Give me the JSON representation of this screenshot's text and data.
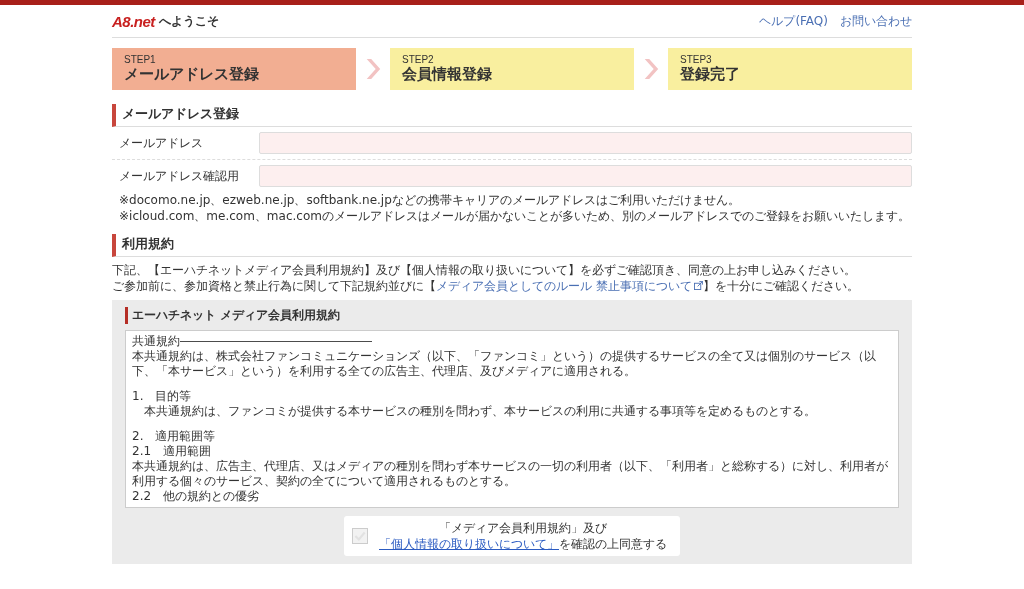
{
  "header": {
    "logo": "A8.net",
    "welcome": "へようこそ",
    "links": [
      "ヘルプ(FAQ)",
      "お問い合わせ"
    ]
  },
  "steps": [
    {
      "step": "STEP1",
      "label": "メールアドレス登録",
      "selected": true
    },
    {
      "step": "STEP2",
      "label": "会員情報登録",
      "selected": false
    },
    {
      "step": "STEP3",
      "label": "登録完了",
      "selected": false
    }
  ],
  "email_section": {
    "title": "メールアドレス登録",
    "fields": [
      {
        "label": "メールアドレス"
      },
      {
        "label": "メールアドレス確認用"
      }
    ],
    "notes": [
      "※docomo.ne.jp、ezweb.ne.jp、softbank.ne.jpなどの携帯キャリアのメールアドレスはご利用いただけません。",
      "※icloud.com、me.com、mac.comのメールアドレスはメールが届かないことが多いため、別のメールアドレスでのご登録をお願いいたします。"
    ]
  },
  "terms_section": {
    "title": "利用規約",
    "intro": "下記、【エーハチネットメディア会員利用規約】及び【個人情報の取り扱いについて】を必ずご確認頂き、同意の上お申し込みください。",
    "rules_before": "ご参加前に、参加資格と禁止行為に関して下記規約並びに【",
    "rules_link": "メディア会員としてのルール 禁止事項について",
    "rules_after": "】を十分にご確認ください。"
  },
  "terms_box": {
    "title": "エーハチネット メディア会員利用規約",
    "lines": [
      {
        "kind": "text",
        "text": "共通規約――――――――――――――――"
      },
      {
        "kind": "text",
        "text": "本共通規約は、株式会社ファンコミュニケーションズ（以下、「ファンコミ」という）の提供するサービスの全て又は個別のサービス（以下、「本サービス」という）を利用する全ての広告主、代理店、及びメディアに適用される。"
      },
      {
        "kind": "blank"
      },
      {
        "kind": "text",
        "text": "1.　目的等"
      },
      {
        "kind": "indent",
        "text": "本共通規約は、ファンコミが提供する本サービスの種別を問わず、本サービスの利用に共通する事項等を定めるものとする。"
      },
      {
        "kind": "blank"
      },
      {
        "kind": "text",
        "text": "2.　適用範囲等"
      },
      {
        "kind": "text",
        "text": "2.1　適用範囲"
      },
      {
        "kind": "text",
        "text": "本共通規約は、広告主、代理店、又はメディアの種別を問わず本サービスの一切の利用者（以下、「利用者」と総称する）に対し、利用者が利用する個々のサービス、契約の全てについて適用されるものとする。"
      },
      {
        "kind": "text",
        "text": "2.2　他の規約との優劣"
      }
    ],
    "consent": {
      "line1": "「メディア会員利用規約」及び",
      "link": "「個人情報の取り扱いについて」",
      "after": "を確認の上同意する",
      "checked": false
    }
  }
}
